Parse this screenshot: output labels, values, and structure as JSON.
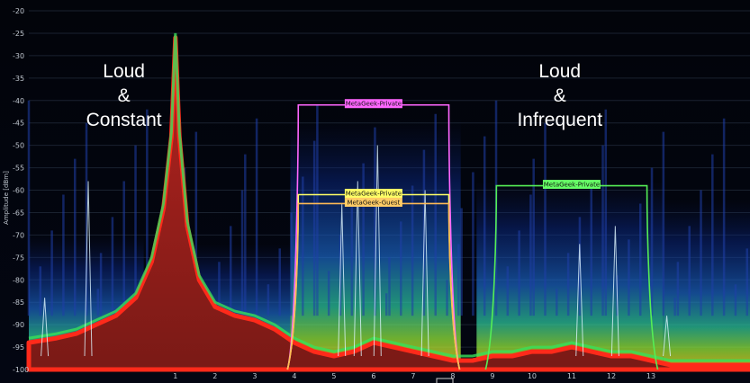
{
  "chart_data": {
    "type": "area",
    "ylabel": "Amplitude [dBm]",
    "ylim": [
      -100,
      -20
    ],
    "xlim": [
      -2.7,
      15.5
    ],
    "yticks": [
      "-20",
      "-25",
      "-30",
      "-35",
      "-40",
      "-45",
      "-50",
      "-55",
      "-60",
      "-65",
      "-70",
      "-75",
      "-80",
      "-85",
      "-90",
      "-95",
      "-100"
    ],
    "xticks": [
      "1",
      "2",
      "3",
      "4",
      "5",
      "6",
      "7",
      "8",
      "9",
      "10",
      "11",
      "12",
      "13"
    ],
    "annotations": [
      {
        "lines": [
          "Loud",
          "&",
          "Constant"
        ],
        "x": -0.3,
        "y": -35
      },
      {
        "lines": [
          "Loud",
          "&",
          "Infrequent"
        ],
        "x": 10.7,
        "y": -35
      }
    ],
    "networks": [
      {
        "name": "MetaGeek-Private",
        "color": "#ff66ff",
        "fill": "#ff66ff",
        "x": [
          4.1,
          7.9
        ],
        "amp": -41
      },
      {
        "name": "MetaGeek-Private",
        "color": "#ffff66",
        "fill": "#ffff66",
        "x": [
          4.1,
          7.9
        ],
        "amp": -61
      },
      {
        "name": "MetaGeek-Guest",
        "color": "#ffbb55",
        "fill": "#ffcc66",
        "x": [
          4.1,
          7.9
        ],
        "amp": -63
      },
      {
        "name": "MetaGeek-Private",
        "color": "#55ee55",
        "fill": "#66ff66",
        "x": [
          9.1,
          12.9
        ],
        "amp": -59
      }
    ],
    "spectrum": {
      "x": [
        -2.7,
        -2.0,
        -1.5,
        -1.0,
        -0.5,
        0.0,
        0.4,
        0.7,
        0.9,
        1.0,
        1.1,
        1.3,
        1.6,
        2.0,
        2.5,
        3.0,
        3.5,
        4.0,
        4.5,
        5.0,
        5.5,
        6.0,
        6.5,
        7.0,
        7.5,
        8.0,
        8.5,
        9.0,
        9.5,
        10.0,
        10.5,
        11.0,
        11.5,
        12.0,
        12.5,
        13.0,
        13.5,
        14.0,
        14.5,
        15.0,
        15.5
      ],
      "values": [
        -94,
        -93,
        -92,
        -90,
        -88,
        -84,
        -76,
        -64,
        -48,
        -26,
        -48,
        -68,
        -80,
        -86,
        -88,
        -89,
        -91,
        -94,
        -96,
        -97,
        -96,
        -94,
        -95,
        -96,
        -97,
        -98,
        -98,
        -97,
        -97,
        -96,
        -96,
        -95,
        -96,
        -97,
        -97,
        -98,
        -99,
        -99,
        -99,
        -99,
        -99
      ]
    },
    "spikes": [
      {
        "x": -1.2,
        "y": -58
      },
      {
        "x": 5.2,
        "y": -63
      },
      {
        "x": 5.6,
        "y": -58
      },
      {
        "x": 6.1,
        "y": -50
      },
      {
        "x": 7.3,
        "y": -60
      },
      {
        "x": 11.2,
        "y": -72
      },
      {
        "x": 12.1,
        "y": -68
      },
      {
        "x": 13.4,
        "y": -88
      },
      {
        "x": -2.3,
        "y": -84
      }
    ]
  }
}
